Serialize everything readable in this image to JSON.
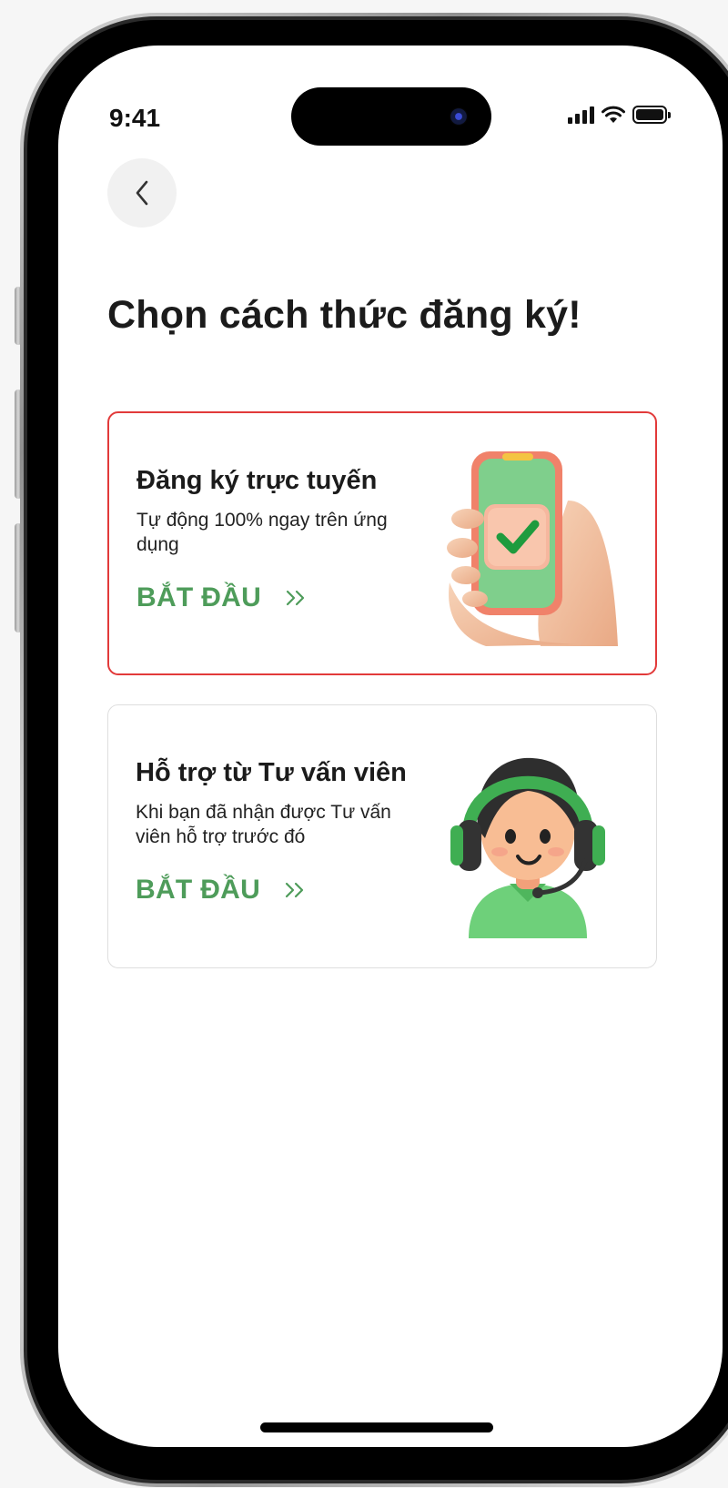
{
  "status_bar": {
    "time": "9:41",
    "icons": [
      "signal-icon",
      "wifi-icon",
      "battery-icon"
    ]
  },
  "header": {
    "back_icon": "chevron-left-icon",
    "title": "Chọn cách thức đăng ký!"
  },
  "options": [
    {
      "title": "Đăng ký trực tuyến",
      "description": "Tự động 100% ngay trên ứng dụng",
      "cta": "BẮT ĐẦU",
      "cta_icon": "double-chevron-right-icon",
      "illustration": "phone-checkmark-icon",
      "selected": true
    },
    {
      "title": "Hỗ trợ từ Tư vấn viên",
      "description": "Khi bạn đã nhận được Tư vấn viên hỗ trợ trước đó",
      "cta": "BẮT ĐẦU",
      "cta_icon": "double-chevron-right-icon",
      "illustration": "support-agent-icon",
      "selected": false
    }
  ],
  "colors": {
    "accent_green": "#4e9c5a",
    "selected_border": "#e23a3a",
    "text_dark": "#1b1b1b"
  }
}
